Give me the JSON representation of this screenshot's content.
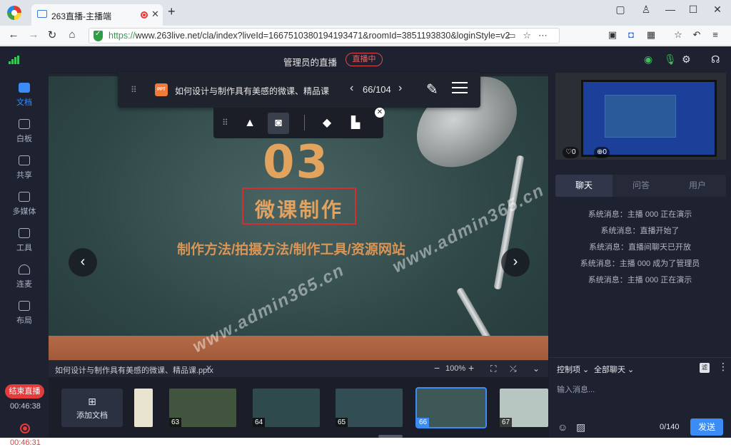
{
  "browser": {
    "tab_title": "263直播-主播端",
    "url_scheme": "https://",
    "url_rest": "www.263live.net/cla/index?liveId=1667510380194193471&roomId=3851193830&loginStyle=v2"
  },
  "header": {
    "room_title": "管理员的直播",
    "live_badge": "直播中"
  },
  "left_nav": {
    "items": [
      {
        "label": "文档",
        "icon": "folder-icon"
      },
      {
        "label": "白板",
        "icon": "whiteboard-icon"
      },
      {
        "label": "共享",
        "icon": "screen-share-icon"
      },
      {
        "label": "多媒体",
        "icon": "media-play-icon"
      },
      {
        "label": "工具",
        "icon": "tools-grid-icon"
      },
      {
        "label": "连麦",
        "icon": "headset-icon"
      },
      {
        "label": "布局",
        "icon": "layout-icon"
      }
    ],
    "end_live": "结束直播",
    "live_time": "00:46:38",
    "rec_time": "00:46:31"
  },
  "doc_toolbar": {
    "doc_title": "如何设计与制作具有美感的微课、精品课",
    "page_indicator": "66/104",
    "ppt_badge": "PPT"
  },
  "slide": {
    "number": "03",
    "title": "微课制作",
    "subtitle": "制作方法/拍摄方法/制作工具/资源网站",
    "watermark1": "www.admin365.cn",
    "watermark2": "www.admin365.cn"
  },
  "file_bar": {
    "file_name": "如何设计与制作具有美感的微课、精品课.pptx",
    "zoom": "100%"
  },
  "thumbs": {
    "add_label": "添加文档",
    "pages": [
      "63",
      "64",
      "65",
      "66",
      "67"
    ]
  },
  "video": {
    "likes": "0",
    "gifts": "0"
  },
  "chat": {
    "tabs": [
      "聊天",
      "问答",
      "用户"
    ],
    "messages": [
      "系统消息：主播 000 正在演示",
      "系统消息：直播开始了",
      "系统消息：直播间聊天已开放",
      "系统消息：主播 000 成为了管理员",
      "系统消息：主播 000 正在演示"
    ],
    "control_label": "控制项",
    "scope_label": "全部聊天",
    "filter_badge": "滤",
    "input_placeholder": "输入消息...",
    "char_count": "0/140",
    "send_label": "发送"
  }
}
